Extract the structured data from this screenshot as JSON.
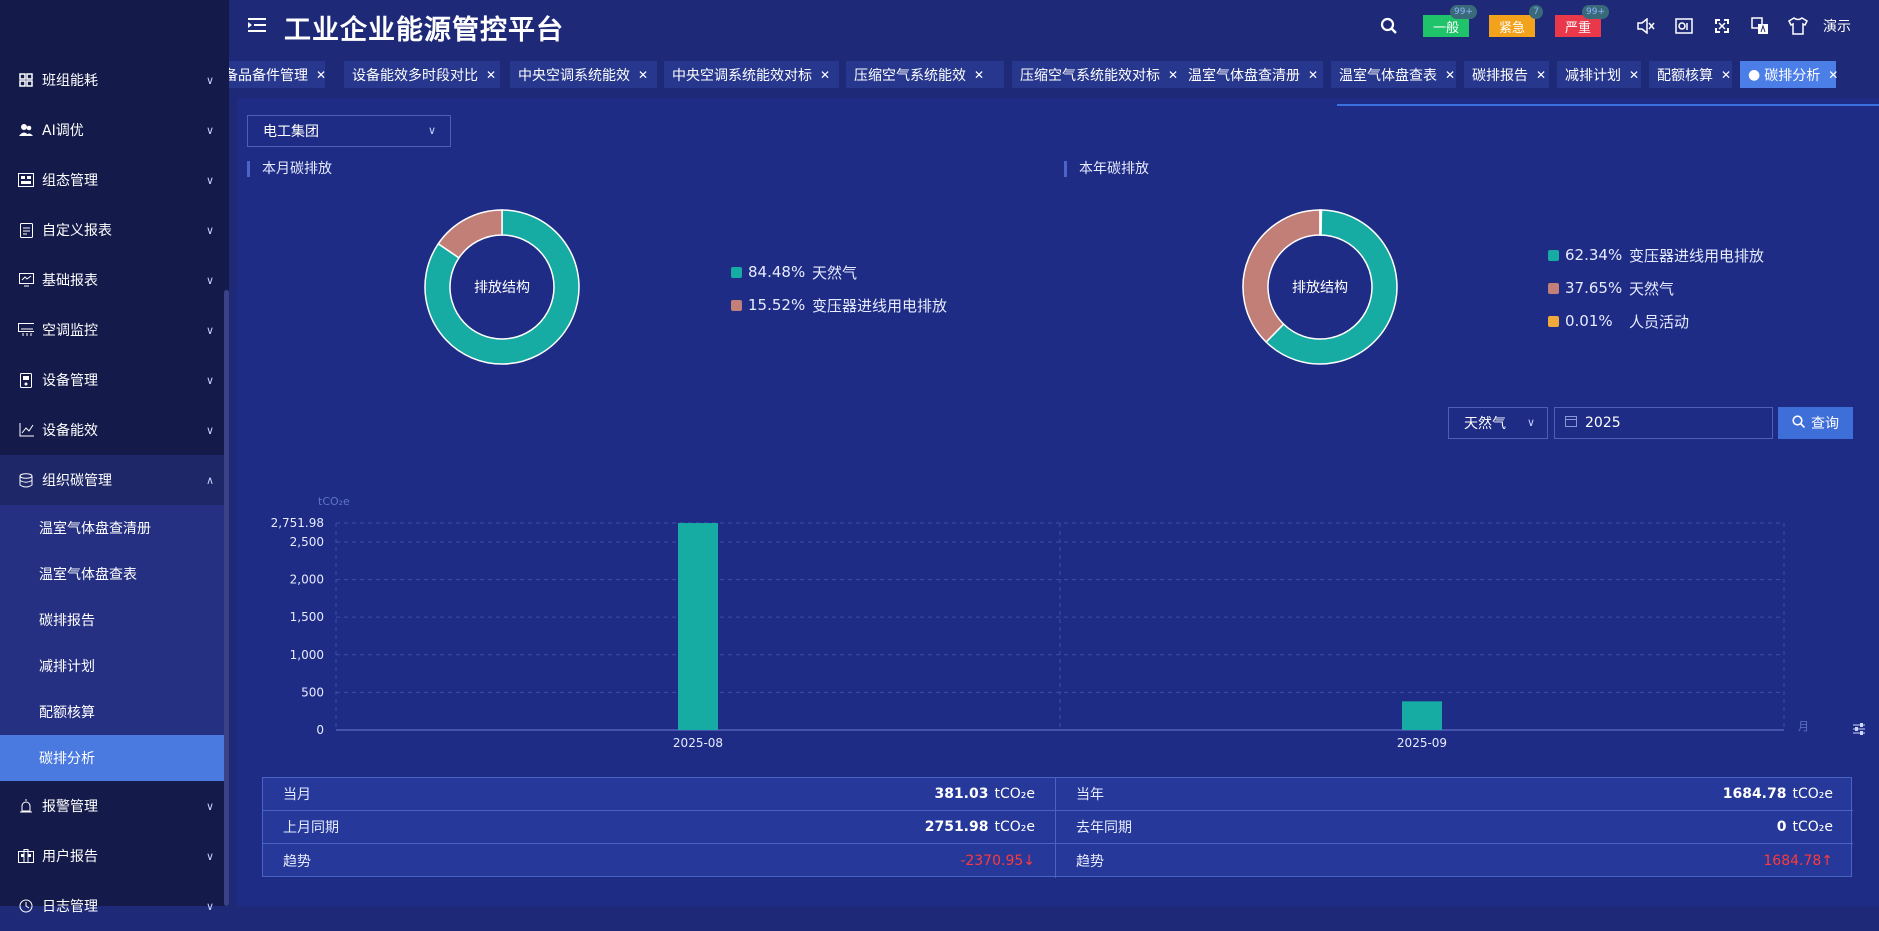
{
  "app": {
    "title": "工业企业能源管控平台",
    "user": "演示"
  },
  "header": {
    "badges": [
      {
        "label": "一般",
        "count": "99+",
        "color": "#1fc36a"
      },
      {
        "label": "紧急",
        "count": "7",
        "color": "#f3a21c"
      },
      {
        "label": "严重",
        "count": "99+",
        "color": "#e8384a"
      }
    ]
  },
  "sidebar": {
    "items": [
      {
        "label": "班组能耗",
        "icon": "grid-icon"
      },
      {
        "label": "AI调优",
        "icon": "users-icon"
      },
      {
        "label": "组态管理",
        "icon": "config-icon"
      },
      {
        "label": "自定义报表",
        "icon": "report-icon"
      },
      {
        "label": "基础报表",
        "icon": "monitor-icon"
      },
      {
        "label": "空调监控",
        "icon": "aircon-icon"
      },
      {
        "label": "设备管理",
        "icon": "device-icon"
      },
      {
        "label": "设备能效",
        "icon": "chart-line-icon"
      },
      {
        "label": "组织碳管理",
        "icon": "database-icon"
      }
    ],
    "sub_items": [
      "温室气体盘查清册",
      "温室气体盘查表",
      "碳排报告",
      "减排计划",
      "配额核算",
      "碳排分析"
    ],
    "bottom_items": [
      {
        "label": "报警管理",
        "icon": "alarm-icon"
      },
      {
        "label": "用户报告",
        "icon": "building-icon"
      },
      {
        "label": "日志管理",
        "icon": "log-icon"
      }
    ]
  },
  "tabs": [
    "备品备件管理",
    "设备能效多时段对比",
    "中央空调系统能效",
    "中央空调系统能效对标",
    "压缩空气系统能效",
    "压缩空气系统能效对标",
    "温室气体盘查清册",
    "温室气体盘查表",
    "碳排报告",
    "减排计划",
    "配额核算",
    "碳排分析"
  ],
  "filter": {
    "org": "电工集团",
    "energy": "天然气",
    "year": "2025",
    "query": "查询"
  },
  "month_section": {
    "title": "本月碳排放",
    "center": "排放结构",
    "legend": [
      {
        "pct": "84.48%",
        "name": "天然气",
        "value": 84.48,
        "color": "#17aca3"
      },
      {
        "pct": "15.52%",
        "name": "变压器进线用电排放",
        "value": 15.52,
        "color": "#c17f78"
      }
    ]
  },
  "year_section": {
    "title": "本年碳排放",
    "center": "排放结构",
    "legend": [
      {
        "pct": "62.34%",
        "name": "变压器进线用电排放",
        "value": 62.34,
        "color": "#17aca3"
      },
      {
        "pct": "37.65%",
        "name": "天然气",
        "value": 37.65,
        "color": "#c17f78"
      },
      {
        "pct": "0.01%",
        "name": "人员活动",
        "value": 0.01,
        "color": "#f0a93b"
      }
    ]
  },
  "chart_data": {
    "type": "bar",
    "unit": "tCO₂e",
    "categories": [
      "2025-08",
      "2025-09"
    ],
    "values": [
      2751.98,
      381.03
    ],
    "ylim": [
      0,
      2751.98
    ],
    "yticks": [
      "0",
      "500",
      "1,000",
      "1,500",
      "2,000",
      "2,500",
      "2,751.98"
    ],
    "color": "#17aca3",
    "xaxis_end_label": "月"
  },
  "summary": {
    "left": [
      {
        "label": "当月",
        "value": "381.03",
        "unit": "tCO₂e"
      },
      {
        "label": "上月同期",
        "value": "2751.98",
        "unit": "tCO₂e"
      },
      {
        "label": "趋势",
        "value": "-2370.95↓",
        "unit": ""
      }
    ],
    "right": [
      {
        "label": "当年",
        "value": "1684.78",
        "unit": "tCO₂e"
      },
      {
        "label": "去年同期",
        "value": "0",
        "unit": "tCO₂e"
      },
      {
        "label": "趋势",
        "value": "1684.78↑",
        "unit": ""
      }
    ]
  }
}
